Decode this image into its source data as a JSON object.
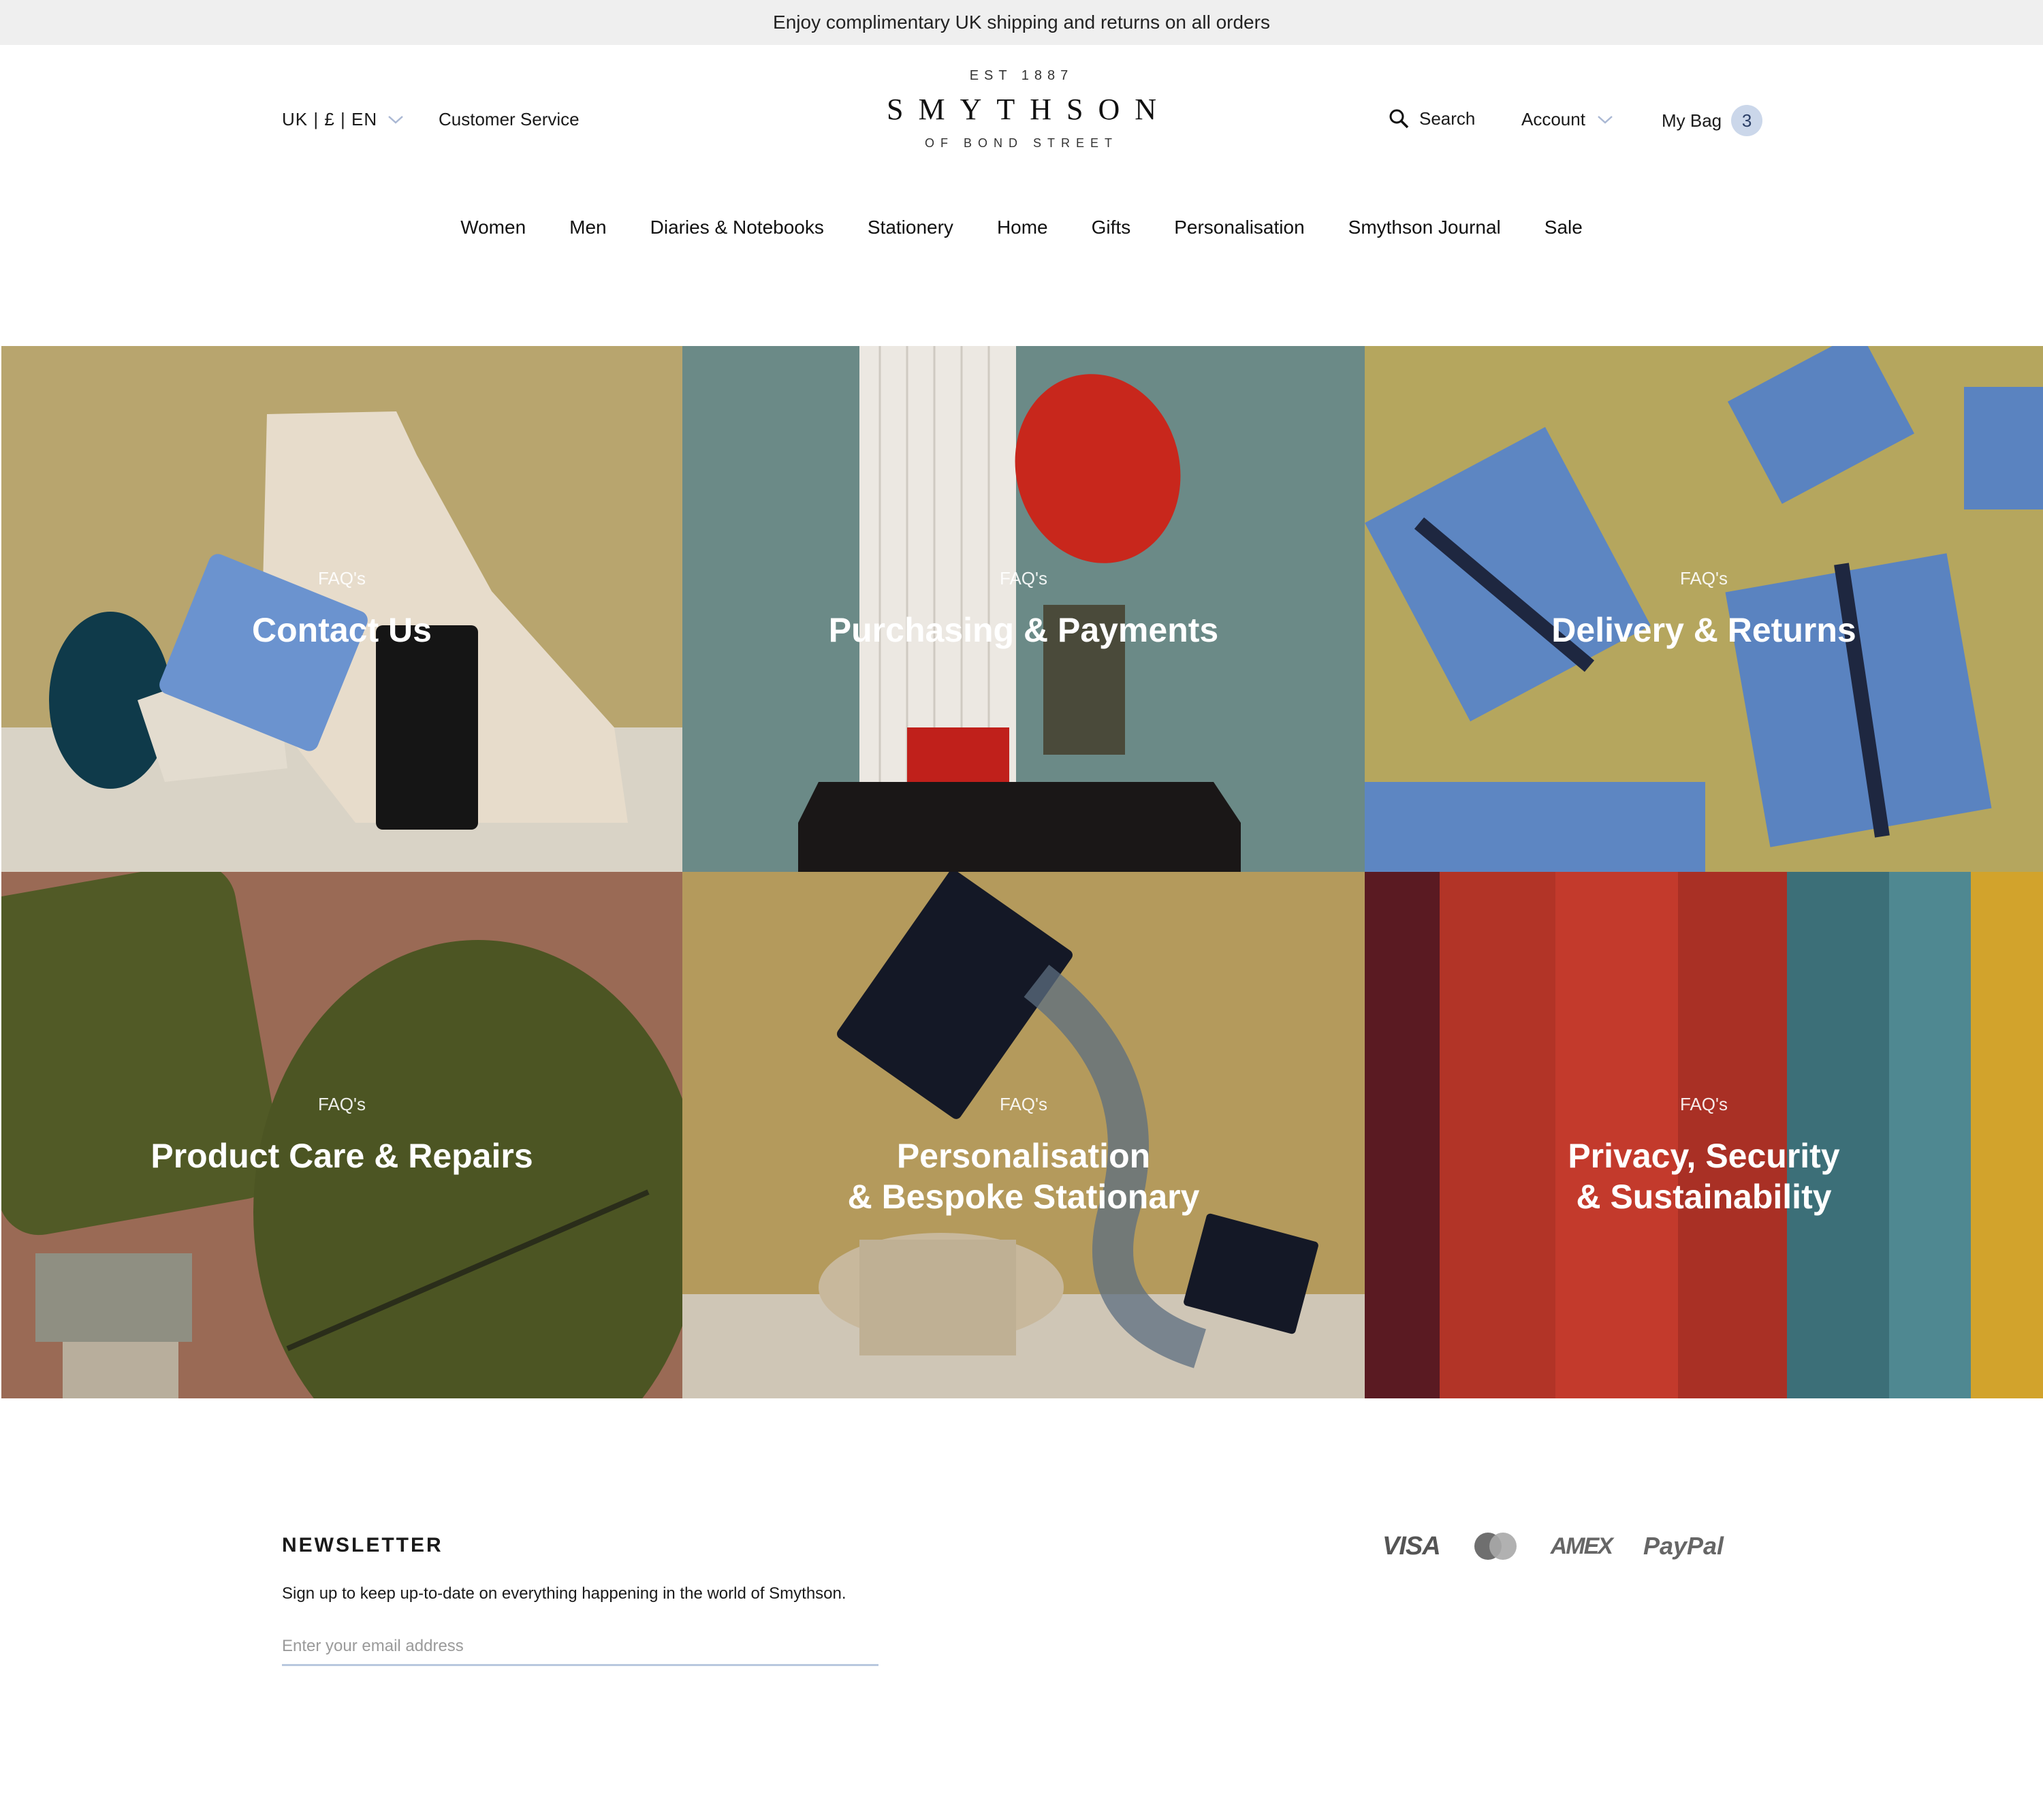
{
  "announcement": "Enjoy complimentary UK shipping and returns on all orders",
  "header": {
    "locale": "UK | £ | EN",
    "customer_service": "Customer Service",
    "logo": {
      "est": "EST 1887",
      "brand": "SMYTHSON",
      "sub": "OF BOND STREET"
    },
    "search": "Search",
    "account": "Account",
    "bag_label": "My Bag",
    "bag_count": "3"
  },
  "nav": [
    "Women",
    "Men",
    "Diaries & Notebooks",
    "Stationery",
    "Home",
    "Gifts",
    "Personalisation",
    "Smythson Journal",
    "Sale"
  ],
  "tiles": [
    {
      "eyebrow": "FAQ's",
      "title": "Contact Us"
    },
    {
      "eyebrow": "FAQ's",
      "title": "Purchasing & Payments"
    },
    {
      "eyebrow": "FAQ's",
      "title": "Delivery & Returns"
    },
    {
      "eyebrow": "FAQ's",
      "title": "Product Care & Repairs"
    },
    {
      "eyebrow": "FAQ's",
      "title": "Personalisation\n& Bespoke Stationary"
    },
    {
      "eyebrow": "FAQ's",
      "title": "Privacy, Security\n& Sustainability"
    }
  ],
  "newsletter": {
    "heading": "NEWSLETTER",
    "text": "Sign up to keep up-to-date on everything happening in the world of Smythson.",
    "placeholder": "Enter your email address"
  },
  "payments": {
    "visa": "VISA",
    "amex": "AMEX",
    "paypal": "PayPal"
  },
  "colors": {
    "announce_bg": "#efefef",
    "bag_badge": "#cbd7ea",
    "input_underline": "#b9c8de"
  }
}
